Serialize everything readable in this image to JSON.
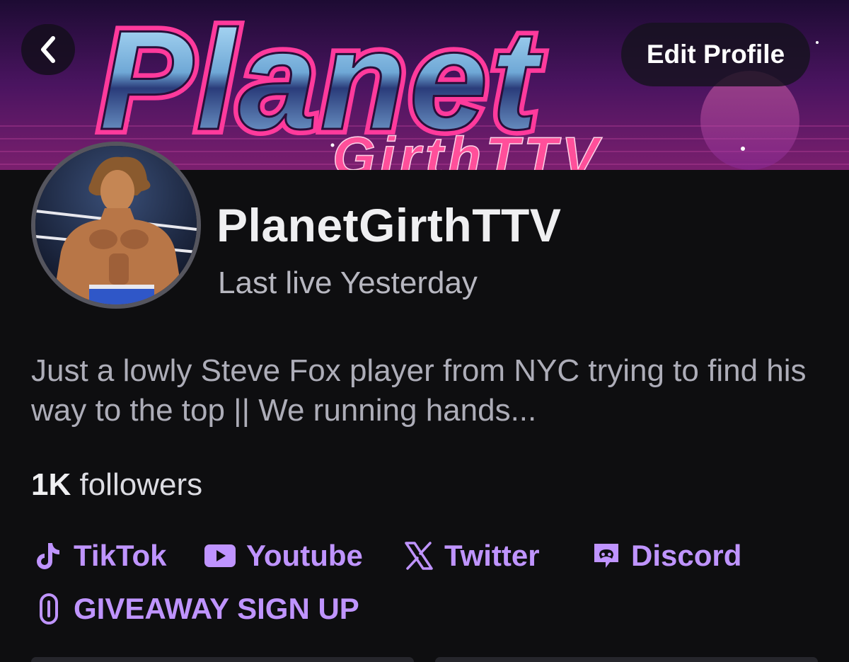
{
  "banner": {
    "art_word": "Planet",
    "art_subword": "GirthTTV"
  },
  "header": {
    "edit_profile_label": "Edit Profile"
  },
  "profile": {
    "channel_name": "PlanetGirthTTV",
    "last_live": "Last live Yesterday",
    "bio": "Just a lowly Steve Fox player from NYC trying to find his way to the top || We running hands...",
    "followers_count": "1K",
    "followers_label": " followers"
  },
  "links": [
    {
      "label": "TikTok",
      "icon": "tiktok-icon"
    },
    {
      "label": "Youtube",
      "icon": "youtube-icon"
    },
    {
      "label": "Twitter",
      "icon": "x-twitter-icon"
    },
    {
      "label": "Discord",
      "icon": "discord-icon"
    },
    {
      "label": "GIVEAWAY SIGN UP",
      "icon": "link-icon"
    }
  ],
  "colors": {
    "background": "#0e0e10",
    "accent": "#bf94ff",
    "text_primary": "#efeff1",
    "text_secondary": "#adadb8"
  }
}
